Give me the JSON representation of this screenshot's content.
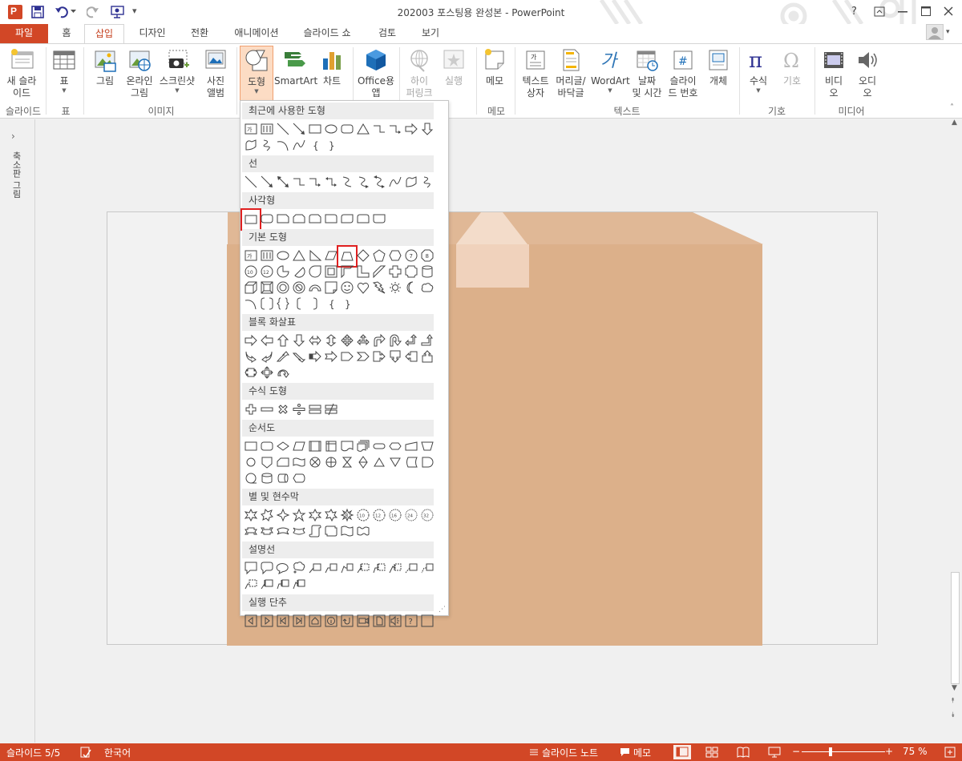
{
  "window": {
    "title": "202003 포스팅용 완성본 - PowerPoint",
    "help": "?"
  },
  "tabs": [
    "파일",
    "홈",
    "삽입",
    "디자인",
    "전환",
    "애니메이션",
    "슬라이드 쇼",
    "검토",
    "보기"
  ],
  "ribbon": {
    "new_slide": [
      "새 슬라",
      "이드"
    ],
    "table": "표",
    "picture": "그림",
    "online_picture": [
      "온라인",
      "그림"
    ],
    "screenshot": "스크린샷",
    "photo_album": [
      "사진",
      "앨범"
    ],
    "shapes": "도형",
    "smartart": "SmartArt",
    "chart": "차트",
    "office_apps": [
      "Office용",
      "앱"
    ],
    "hyperlink": [
      "하이",
      "퍼링크"
    ],
    "action": "실행",
    "comment": "메모",
    "textbox": [
      "텍스트",
      "상자"
    ],
    "header_footer": [
      "머리글/",
      "바닥글"
    ],
    "wordart": "WordArt",
    "date_time": [
      "날짜",
      "및 시간"
    ],
    "slide_number": [
      "슬라이",
      "드 번호"
    ],
    "object": "개체",
    "equation": "수식",
    "symbol": "기호",
    "video": [
      "비디",
      "오"
    ],
    "audio": [
      "오디",
      "오"
    ],
    "groups": {
      "slides": "슬라이드",
      "tables": "표",
      "images": "이미지",
      "comments": "메모",
      "text": "텍스트",
      "symbols": "기호",
      "media": "미디어"
    }
  },
  "thumb_pane": {
    "label": "축소판 그림"
  },
  "gallery": {
    "sections": [
      {
        "title": "최근에 사용한 도형",
        "rows": [
          [
            "textbox",
            "vtextbox",
            "line",
            "arrowline",
            "rect",
            "oval",
            "roundrect",
            "triangle",
            "elbow",
            "elbowarrow",
            "rightarrow",
            "downarrow"
          ],
          [
            "freeform",
            "scribble",
            "arc",
            "curve",
            "lbrace",
            "rbrace"
          ]
        ]
      },
      {
        "title": "선",
        "rows": [
          [
            "line",
            "arrowline",
            "dblarrowline",
            "elbow",
            "elbowarrow",
            "elbowdblarrow",
            "curve2",
            "curvearrow",
            "curvedblarrow",
            "curve",
            "freeform",
            "scribble"
          ]
        ]
      },
      {
        "title": "사각형",
        "rows": [
          [
            "rect",
            "roundrect",
            "snip1",
            "snip2",
            "snipround",
            "round1",
            "round2",
            "roundsame",
            "roundsame2"
          ]
        ]
      },
      {
        "title": "기본 도형",
        "rows": [
          [
            "textbox",
            "vtextbox",
            "oval",
            "triangle",
            "rtriangle",
            "parallelogram",
            "trapezoid",
            "diamond",
            "pentagon",
            "hexagon",
            "heptagon",
            "octagon"
          ],
          [
            "decagon",
            "dodecagon",
            "pie",
            "chord",
            "teardrop",
            "frame",
            "halfframe",
            "lshape",
            "diagstripe",
            "plus",
            "plaque",
            "can"
          ],
          [
            "cube",
            "bevel",
            "donut",
            "nosymbol",
            "blockarc",
            "foldedcorner",
            "smiley",
            "heart",
            "lightning",
            "sun",
            "moon",
            "cloud"
          ],
          [
            "arc",
            "dblbracket",
            "dblbrace",
            "lbracket",
            "rbracket",
            "lbrace",
            "rbrace"
          ]
        ]
      },
      {
        "title": "블록 화살표",
        "rows": [
          [
            "rightarrow",
            "leftarrow",
            "uparrow",
            "downarrow",
            "lrarrow",
            "udarrow",
            "quadarrow",
            "lruarrow",
            "bentarrow",
            "uturn",
            "leftuparrow",
            "bentuparrow"
          ],
          [
            "curvedright",
            "curvedleft",
            "curvedup",
            "curveddown",
            "stripedright",
            "notchedright",
            "pentagonarrow",
            "chevron",
            "rightcallout",
            "downcallout",
            "leftcallout",
            "upcallout"
          ],
          [
            "lrcallout",
            "quadcallout",
            "circulararrow"
          ]
        ]
      },
      {
        "title": "수식 도형",
        "rows": [
          [
            "mathplus",
            "mathminus",
            "mathmultiply",
            "mathdivide",
            "mathequal",
            "mathnotequal"
          ]
        ]
      },
      {
        "title": "순서도",
        "rows": [
          [
            "process",
            "altprocess",
            "decision",
            "data",
            "predefined",
            "internal",
            "document",
            "multidoc",
            "terminator",
            "preparation",
            "manualinput",
            "manualop"
          ],
          [
            "connector",
            "offpage",
            "card",
            "punchedtape",
            "summing",
            "or",
            "collate",
            "sort",
            "extract",
            "merge",
            "stored",
            "delay"
          ],
          [
            "sequential",
            "magdisk",
            "directaccess",
            "display"
          ]
        ]
      },
      {
        "title": "별 및 현수막",
        "rows": [
          [
            "explosion1",
            "explosion2",
            "star4",
            "star5",
            "star6",
            "star7",
            "star8",
            "star10",
            "star12",
            "star16",
            "star24",
            "star32"
          ],
          [
            "ribbonup",
            "ribbondown",
            "curvedribbonup",
            "curvedribbondown",
            "vscroll",
            "hscroll",
            "wave",
            "dblwave"
          ]
        ]
      },
      {
        "title": "설명선",
        "rows": [
          [
            "rectcallout",
            "roundcallout",
            "ovalcallout",
            "cloudcallout",
            "line1",
            "line2",
            "line3",
            "accent1",
            "accent2",
            "accent3",
            "border1",
            "border2"
          ],
          [
            "border3",
            "accentborder1",
            "accentborder2",
            "accentborder3"
          ]
        ]
      },
      {
        "title": "실행 단추",
        "rows": [
          [
            "back",
            "forward",
            "beginning",
            "end",
            "home",
            "info",
            "return",
            "movie",
            "docbtn",
            "sound",
            "help",
            "blank"
          ]
        ]
      }
    ]
  },
  "status": {
    "slide": "슬라이드 5/5",
    "lang": "한국어",
    "notes": "슬라이드 노트",
    "comments": "메모",
    "zoom": "75 %"
  },
  "colors": {
    "accent": "#d24726",
    "box": "#dcb08a",
    "box_top": "#e0b896",
    "tape": "#f0d2bc",
    "tape_top": "#f6e2d4",
    "highlight": "#e02020"
  }
}
